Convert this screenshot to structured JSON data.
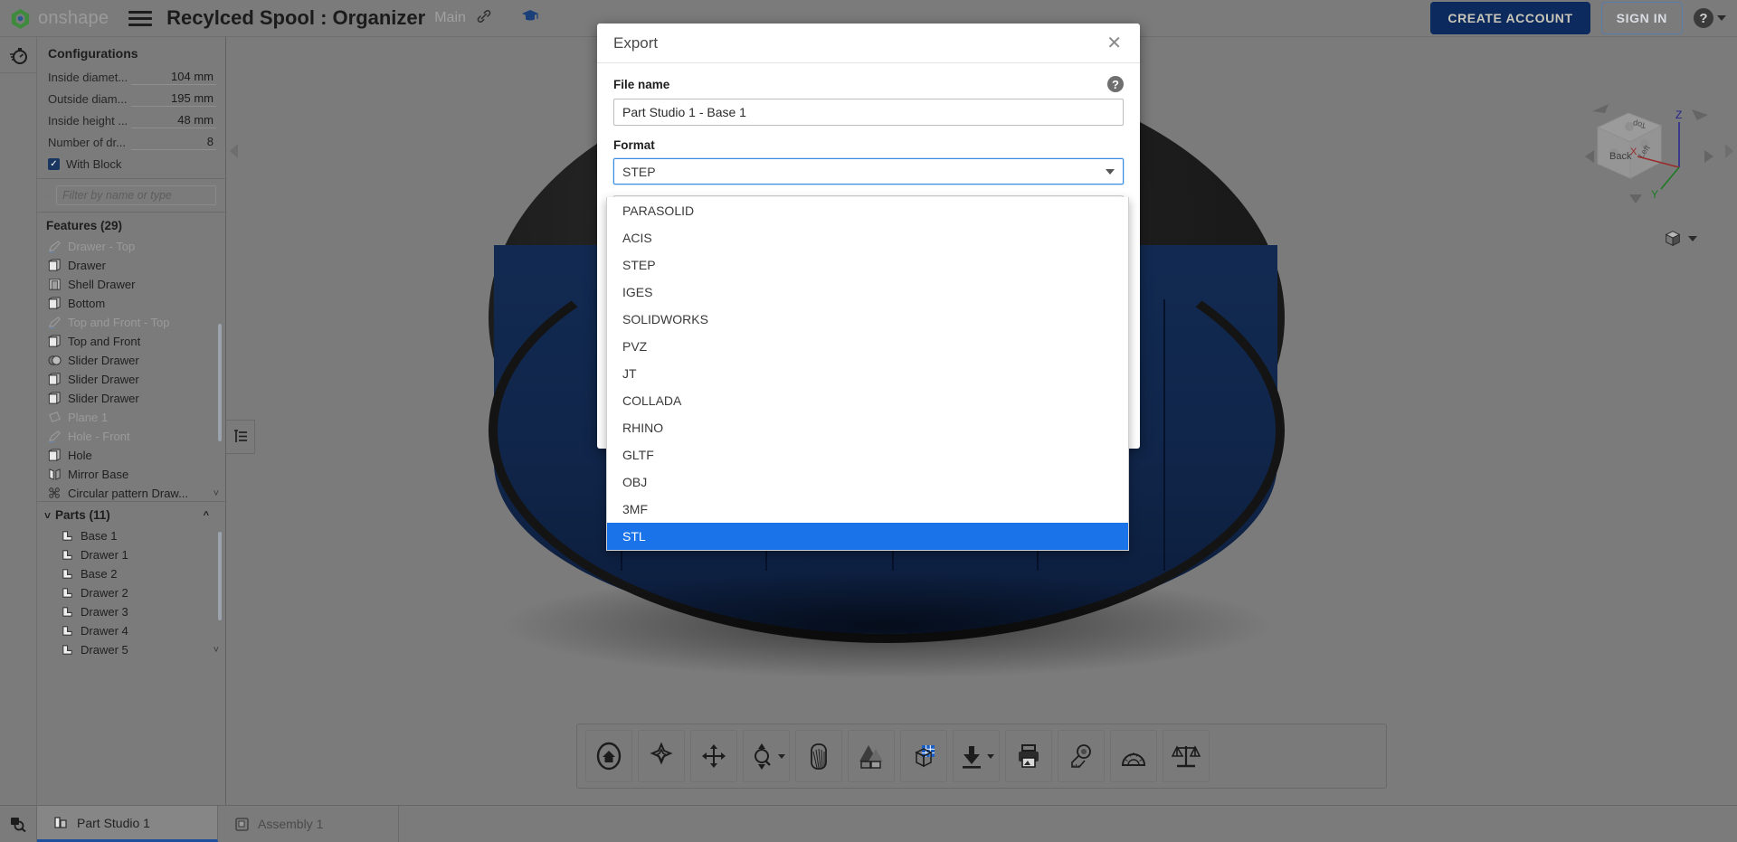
{
  "topbar": {
    "brand": "onshape",
    "doc_title": "Recylced Spool : Organizer",
    "branch": "Main",
    "link_icon": "link-icon",
    "learning_icon": "graduation-cap-icon",
    "create_account": "CREATE ACCOUNT",
    "sign_in": "SIGN IN",
    "help_glyph": "?",
    "menu_icon": "hamburger-menu-icon"
  },
  "left_strip": {
    "timer_icon": "stopwatch-icon"
  },
  "configurations": {
    "title": "Configurations",
    "rows": [
      {
        "label": "Inside diamet...",
        "value": "104 mm"
      },
      {
        "label": "Outside diam...",
        "value": "195 mm"
      },
      {
        "label": "Inside height ...",
        "value": "48 mm"
      },
      {
        "label": "Number of dr...",
        "value": "8"
      }
    ],
    "checkbox_label": "With Block",
    "checkbox_checked": true
  },
  "filter": {
    "icon": "funnel-icon",
    "placeholder": "Filter by name or type"
  },
  "features": {
    "title": "Features (29)",
    "collapse_icon": "chevron-up-icon",
    "items": [
      {
        "label": "Drawer - Top",
        "icon": "sketch-icon",
        "dim": true,
        "chevron": false
      },
      {
        "label": "Drawer",
        "icon": "extrude-icon",
        "dim": false,
        "chevron": false
      },
      {
        "label": "Shell Drawer",
        "icon": "shell-icon",
        "dim": false,
        "chevron": false
      },
      {
        "label": "Bottom",
        "icon": "extrude-icon",
        "dim": false,
        "chevron": false
      },
      {
        "label": "Top and Front - Top",
        "icon": "sketch-icon",
        "dim": true,
        "chevron": false
      },
      {
        "label": "Top and Front",
        "icon": "extrude-icon",
        "dim": false,
        "chevron": false
      },
      {
        "label": "Slider Drawer",
        "icon": "boolean-icon",
        "dim": false,
        "chevron": false
      },
      {
        "label": "Slider Drawer",
        "icon": "extrude-icon",
        "dim": false,
        "chevron": false
      },
      {
        "label": "Slider Drawer",
        "icon": "extrude-icon",
        "dim": false,
        "chevron": false
      },
      {
        "label": "Plane 1",
        "icon": "plane-icon",
        "dim": true,
        "chevron": false
      },
      {
        "label": "Hole - Front",
        "icon": "sketch-icon",
        "dim": true,
        "chevron": false
      },
      {
        "label": "Hole",
        "icon": "extrude-icon",
        "dim": false,
        "chevron": false
      },
      {
        "label": "Mirror Base",
        "icon": "mirror-icon",
        "dim": false,
        "chevron": false
      },
      {
        "label": "Circular pattern Draw...",
        "icon": "pattern-icon",
        "dim": false,
        "chevron": true
      }
    ]
  },
  "parts": {
    "title": "Parts (11)",
    "expand_icon": "chevron-down-icon",
    "collapse_icon": "chevron-up-icon",
    "more_icon": "chevron-down-icon",
    "items": [
      {
        "label": "Base 1",
        "icon": "part-icon"
      },
      {
        "label": "Drawer 1",
        "icon": "part-icon"
      },
      {
        "label": "Base 2",
        "icon": "part-icon"
      },
      {
        "label": "Drawer 2",
        "icon": "part-icon"
      },
      {
        "label": "Drawer 3",
        "icon": "part-icon"
      },
      {
        "label": "Drawer 4",
        "icon": "part-icon"
      },
      {
        "label": "Drawer 5",
        "icon": "part-icon"
      }
    ]
  },
  "notes_tab": {
    "icon": "feature-list-icon"
  },
  "viewcube": {
    "face_back": "Back",
    "face_top": "Top",
    "face_left": "Left",
    "axis_x": "X",
    "axis_y": "Y",
    "axis_z": "Z",
    "display_icon": "view-cube-icon",
    "display_caret": "chevron-down-icon"
  },
  "bottom_toolbar": {
    "buttons": [
      {
        "name": "home-view-button",
        "icon": "home-icon",
        "caret": false
      },
      {
        "name": "view-orientation-button",
        "icon": "orientation-icon",
        "caret": false
      },
      {
        "name": "pan-button",
        "icon": "move-arrows-icon",
        "caret": false
      },
      {
        "name": "zoom-button",
        "icon": "zoom-icon",
        "caret": true
      },
      {
        "name": "section-view-button",
        "icon": "section-icon",
        "caret": false
      },
      {
        "name": "render-button",
        "icon": "render-icon",
        "caret": false
      },
      {
        "name": "display-mode-button",
        "icon": "display-grid-icon",
        "caret": false
      },
      {
        "name": "export-button",
        "icon": "download-icon",
        "caret": true
      },
      {
        "name": "print-button",
        "icon": "print-icon",
        "caret": false
      },
      {
        "name": "measure-tape-button",
        "icon": "measure-tape-icon",
        "caret": false
      },
      {
        "name": "protractor-button",
        "icon": "protractor-icon",
        "caret": false
      },
      {
        "name": "mass-properties-button",
        "icon": "scale-icon",
        "caret": false
      }
    ]
  },
  "bottom_tabs": {
    "search_icon": "tab-search-icon",
    "tabs": [
      {
        "label": "Part Studio 1",
        "icon": "part-studio-icon",
        "active": true
      },
      {
        "label": "Assembly 1",
        "icon": "assembly-icon",
        "active": false
      }
    ]
  },
  "export_dialog": {
    "title": "Export",
    "close_icon": "close-icon",
    "help_icon": "help-icon",
    "file_name_label": "File name",
    "file_name_value": "Part Studio 1 - Base 1",
    "format_label": "Format",
    "format_value": "STEP",
    "format_caret_icon": "chevron-down-icon",
    "format_options": [
      "PARASOLID",
      "ACIS",
      "STEP",
      "IGES",
      "SOLIDWORKS",
      "PVZ",
      "JT",
      "COLLADA",
      "RHINO",
      "GLTF",
      "OBJ",
      "3MF",
      "STL"
    ],
    "selected_option": "STL"
  },
  "colors": {
    "accent_blue": "#1a73e8",
    "focus_blue": "#3a8be0",
    "brand_navy": "#0c2a5e",
    "panel_gray": "#7b7b7b",
    "model_navy": "#102549",
    "model_black": "#1d1d1d"
  }
}
